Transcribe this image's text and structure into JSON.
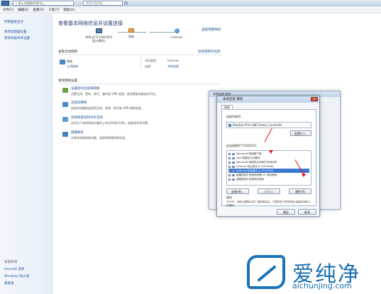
{
  "window": {
    "address": "« 网 ▸ 网络和共享中心",
    "search_placeholder": "搜索控制面板"
  },
  "menu": [
    "文件(F)",
    "编辑(E)",
    "查看(V)",
    "工具(T)",
    "帮助(H)"
  ],
  "sidebar": {
    "items": [
      "控制面板主页",
      "更改适配器设置",
      "更改高级共享设置"
    ],
    "see_also_title": "另请参阅",
    "see_also": [
      "Internet 选项",
      "Windows 防火墙",
      "家庭组"
    ]
  },
  "main": {
    "title": "查看基本网络信息并设置连接",
    "full_map_link": "查看完整映射",
    "map": {
      "computer": "WIN-JE7C1AKA3ED",
      "computer_sub": "(此计算机)",
      "network": "网络",
      "internet": "Internet"
    },
    "active_section": "查看活动网络",
    "connect_link": "连接或断开连接",
    "network_name": "网络",
    "network_type": "公用网络",
    "access_type_label": "访问类型:",
    "access_type_value": "Internet",
    "connection_label": "连接:",
    "connection_value": "本地连接",
    "change_section": "更改网络设置",
    "tasks": [
      {
        "link": "设置新的连接或网络",
        "desc": "设置无线、宽带、拨号、临时或 VPN 连接；或设置路由器或访问点。"
      },
      {
        "link": "连接到网络",
        "desc": "连接到或重新连接到无线、有线、拨号或 VPN 网络连接。"
      },
      {
        "link": "选择家庭组和共享选项",
        "desc": "访问位于其他网络计算机上的文件和打印机，或更改共享设置。"
      },
      {
        "link": "疑难解答",
        "desc": "诊断并修复网络问题，或获得故障排除信息。"
      }
    ]
  },
  "status_dialog": {
    "title": "本地连接 状态"
  },
  "props_dialog": {
    "title": "本地连接 属性",
    "tab": "网络",
    "connect_using_label": "连接时使用:",
    "adapter": "Realtek PCIe GBE Family Controller",
    "configure_button": "配置(C)...",
    "items_label": "此连接使用下列项目(O):",
    "items": [
      "Microsoft 网络客户端",
      "QoS 数据包计划程序",
      "Microsoft 网络的文件和打印机共享",
      "Internet 协议版本 6 (TCP/IPv6)",
      "Internet 协议版本 4 (TCP/IPv4)",
      "链路层拓扑发现映射器 I/O 驱动程序",
      "链路层拓扑发现响应程序"
    ],
    "selected_index": 4,
    "install_button": "安装(N)...",
    "uninstall_button": "卸载(U)",
    "properties_button": "属性(R)",
    "desc_label": "描述",
    "desc_text": "TCP/IP。该协议是默认的广域网络协议，它提供在不同的相互连接的网络上的通讯。",
    "ok_button": "确定",
    "cancel_button": "取消"
  },
  "watermark": {
    "text": "爱纯净",
    "url": "aichunjing.com"
  },
  "colors": {
    "accent": "#1e4f95",
    "arrow": "#dd1111",
    "selection": "#3c78d0",
    "watermark": "#1b6fb0"
  }
}
